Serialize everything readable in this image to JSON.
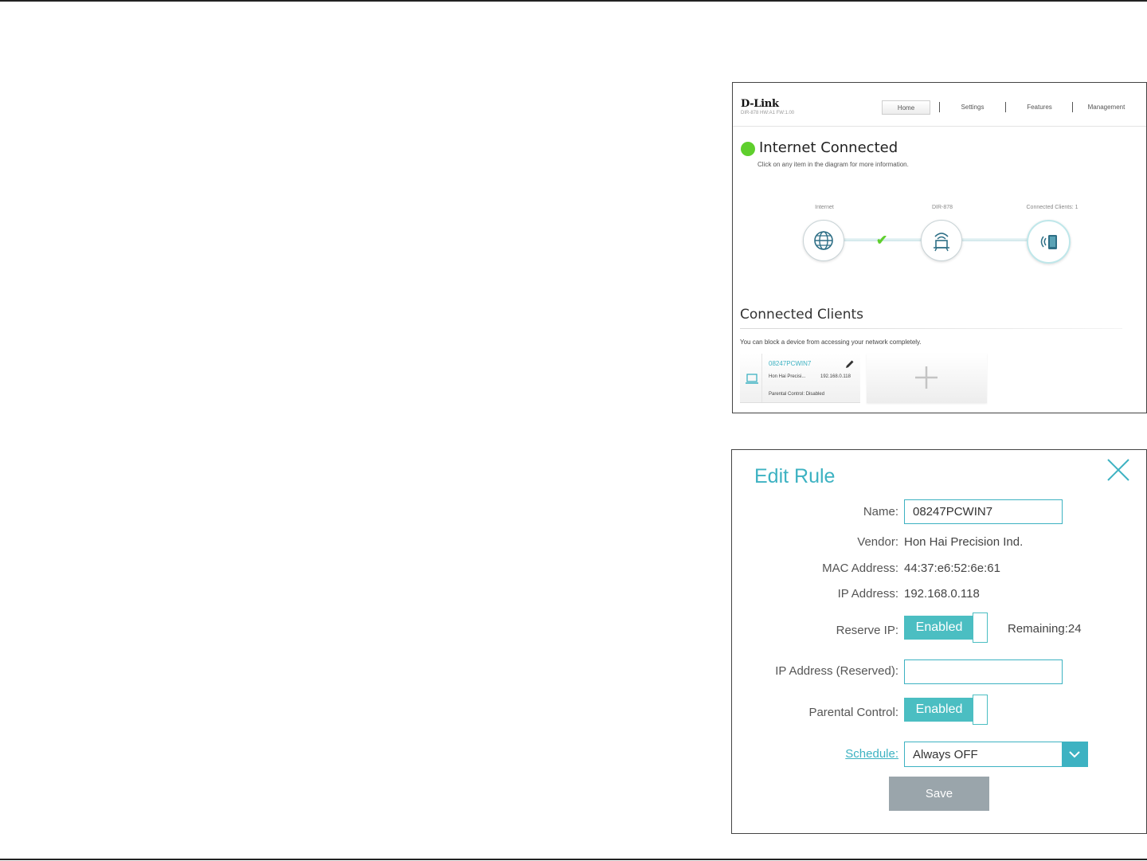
{
  "home": {
    "logo": "D-Link",
    "firmware": "DIR-878 HW:A1 FW:1.00",
    "nav": [
      "Home",
      "Settings",
      "Features",
      "Management"
    ],
    "status_title": "Internet Connected",
    "status_subtitle": "Click on any item in the diagram for more information.",
    "diagram": {
      "internet_label": "Internet",
      "router_label": "DIR-878",
      "clients_label": "Connected Clients: 1"
    },
    "connected_clients": {
      "title": "Connected Clients",
      "subtitle": "You can block a device from accessing your network completely.",
      "client": {
        "name": "08247PCWIN7",
        "vendor": "Hon Hai Precisi...",
        "ip": "192.168.0.118",
        "parental_control": "Parental Control: Disabled"
      }
    }
  },
  "edit_rule": {
    "title": "Edit Rule",
    "labels": {
      "name": "Name:",
      "vendor": "Vendor:",
      "mac": "MAC Address:",
      "ip": "IP Address:",
      "reserve_ip": "Reserve IP:",
      "ip_reserved": "IP Address (Reserved):",
      "parental_control": "Parental Control:",
      "schedule": "Schedule:"
    },
    "values": {
      "name": "08247PCWIN7",
      "vendor": "Hon Hai Precision Ind.",
      "mac": "44:37:e6:52:6e:61",
      "ip": "192.168.0.118",
      "reserve_ip_state": "Enabled",
      "remaining": "Remaining:24",
      "ip_reserved": "",
      "parental_control_state": "Enabled",
      "schedule": "Always OFF"
    },
    "save_label": "Save"
  },
  "colors": {
    "accent": "#3db2c2",
    "toggle_on": "#4bbec2",
    "status_green": "#5fcf2d",
    "save_button": "#9aa5ab"
  }
}
